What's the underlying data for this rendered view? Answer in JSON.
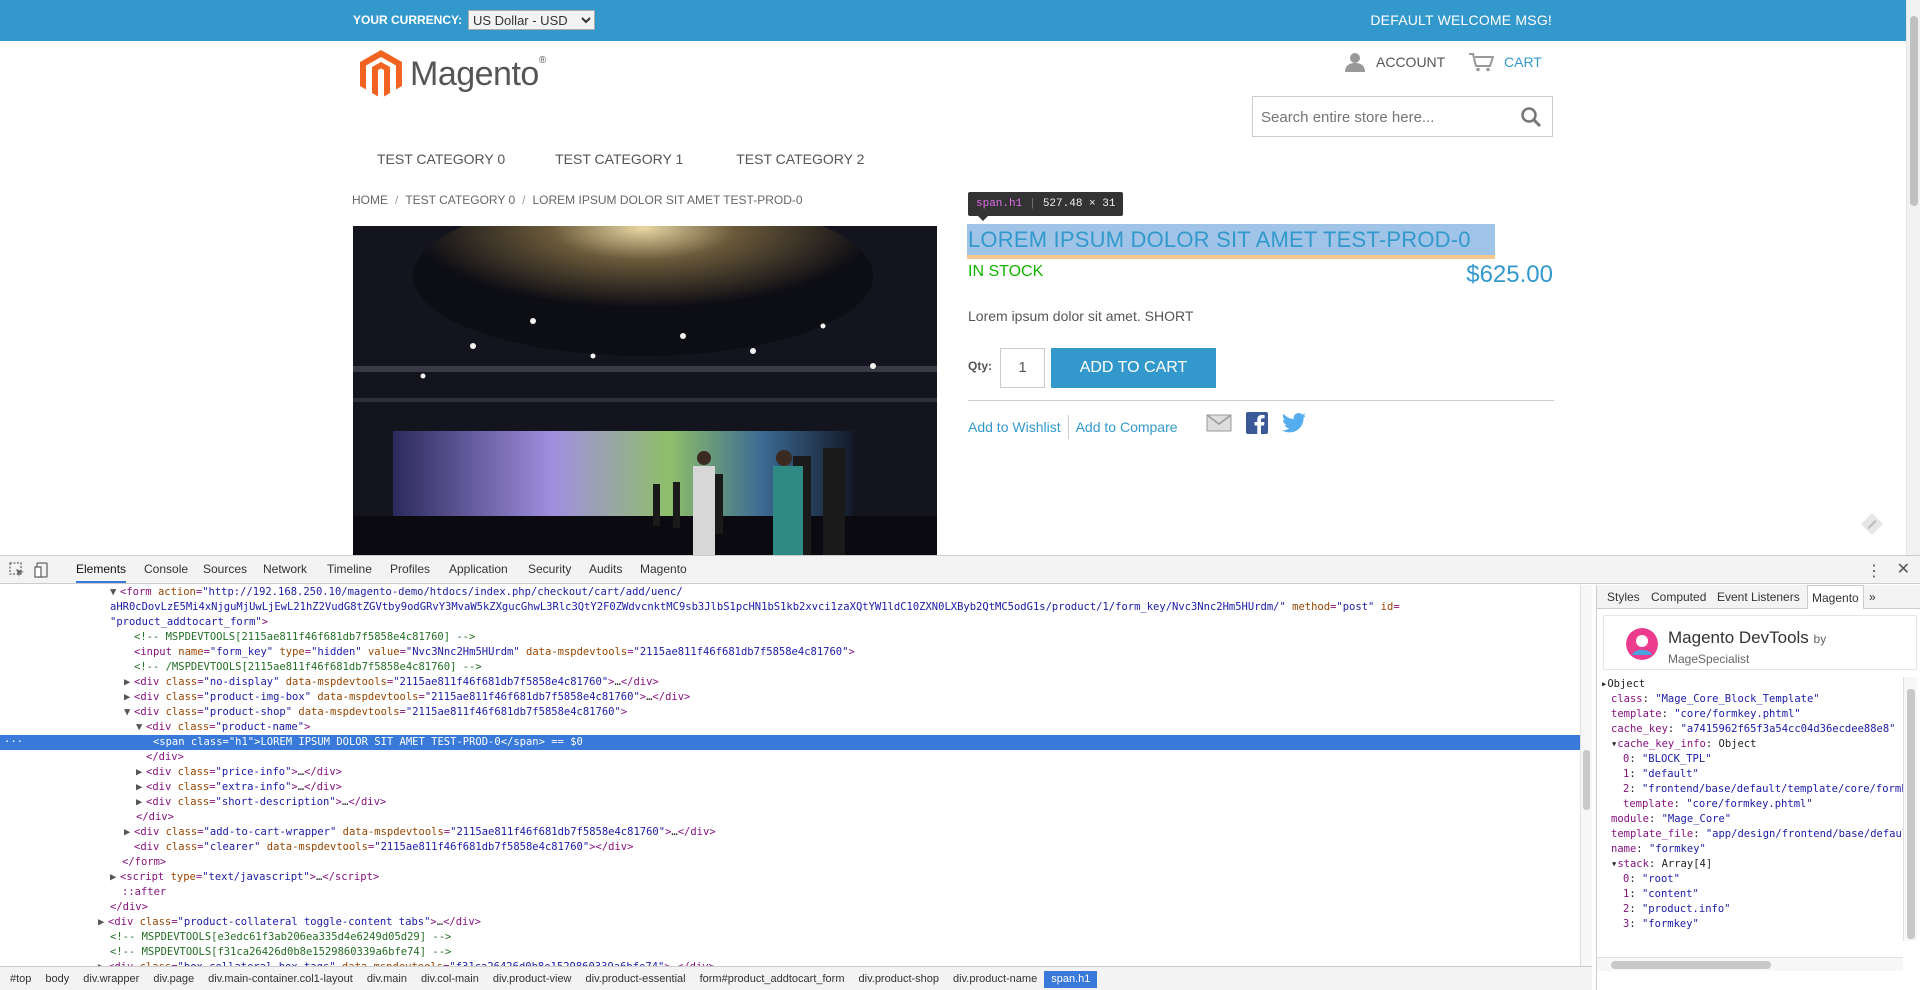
{
  "store": {
    "currency_label": "YOUR CURRENCY:",
    "currency_value": "US Dollar - USD",
    "welcome": "DEFAULT WELCOME MSG!",
    "logo_text": "Magento",
    "logo_mark": "®",
    "account_label": "ACCOUNT",
    "cart_label": "CART",
    "search_placeholder": "Search entire store here...",
    "nav": [
      "TEST CATEGORY 0",
      "TEST CATEGORY 1",
      "TEST CATEGORY 2"
    ],
    "breadcrumbs": [
      "HOME",
      "TEST CATEGORY 0",
      "LOREM IPSUM DOLOR SIT AMET TEST-PROD-0"
    ],
    "breadcrumb_sep": "/",
    "product": {
      "title": "LOREM IPSUM DOLOR SIT AMET TEST-PROD-0",
      "stock": "IN STOCK",
      "price": "$625.00",
      "short_description": "Lorem ipsum dolor sit amet. SHORT",
      "qty_label": "Qty:",
      "qty_value": "1",
      "add_to_cart": "ADD TO CART",
      "wishlist": "Add to Wishlist",
      "compare": "Add to Compare"
    },
    "inspect_tooltip": {
      "selector": "span.h1",
      "size": "527.48 × 31"
    },
    "colors": {
      "brand": "#3399cc",
      "stock": "#11b400"
    }
  },
  "devtools": {
    "tabs": [
      "Elements",
      "Console",
      "Sources",
      "Network",
      "Timeline",
      "Profiles",
      "Application",
      "Security",
      "Audits",
      "Magento"
    ],
    "active_tab": "Elements",
    "more": "⋮",
    "close": "✕",
    "selected_suffix": " == $0",
    "breadcrumbs": [
      "#top",
      "body",
      "div.wrapper",
      "div.page",
      "div.main-container.col1-layout",
      "div.main",
      "div.col-main",
      "div.product-view",
      "div.product-essential",
      "form#product_addtocart_form",
      "div.product-shop",
      "div.product-name",
      "span.h1"
    ],
    "side_tabs": [
      "Styles",
      "Computed",
      "Event Listeners",
      "Magento"
    ],
    "side_more": "»",
    "magento_devtools": {
      "title": "Magento DevTools",
      "by": "by",
      "vendor": "MageSpecialist"
    },
    "object": [
      {
        "k": "",
        "v": "Object"
      },
      {
        "k": "class",
        "v": "\"Mage_Core_Block_Template\""
      },
      {
        "k": "template",
        "v": "\"core/formkey.phtml\""
      },
      {
        "k": "cache_key",
        "v": "\"a7415962f65f3a54cc04d36ecdee88e8\""
      },
      {
        "k": "cache_key_info",
        "v": "Object"
      },
      {
        "k": "0",
        "v": "\"BLOCK_TPL\""
      },
      {
        "k": "1",
        "v": "\"default\""
      },
      {
        "k": "2",
        "v": "\"frontend/base/default/template/core/formkey.phtml\""
      },
      {
        "k": "template",
        "v": "\"core/formkey.phtml\""
      },
      {
        "k": "module",
        "v": "\"Mage_Core\""
      },
      {
        "k": "template_file",
        "v": "\"app/design/frontend/base/default/template/core/formkey.phtml\""
      },
      {
        "k": "name",
        "v": "\"formkey\""
      },
      {
        "k": "stack",
        "v": "Array[4]"
      },
      {
        "k": "0",
        "v": "\"root\""
      },
      {
        "k": "1",
        "v": "\"content\""
      },
      {
        "k": "2",
        "v": "\"product.info\""
      },
      {
        "k": "3",
        "v": "\"formkey\""
      }
    ]
  }
}
